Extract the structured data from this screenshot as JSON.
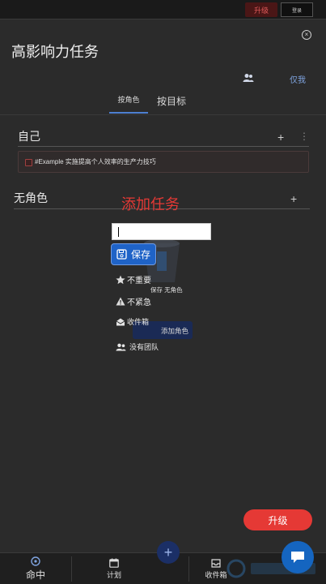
{
  "topbar": {
    "upgrade_label": "升级",
    "user_label": "登录"
  },
  "header": {
    "title": "高影响力任务",
    "only_me": "仅我"
  },
  "tabs": [
    {
      "label": "按角色",
      "active": true
    },
    {
      "label": "按目标",
      "active": false
    }
  ],
  "sections": [
    {
      "title": "自己"
    },
    {
      "title": "无角色"
    }
  ],
  "task": {
    "text": "#Example 实施提高个人效率的生产力技巧"
  },
  "background": {
    "save_label": "保存 无角色",
    "add_role_label": "添加角色"
  },
  "dialog": {
    "title": "添加任务",
    "input_value": "",
    "save_label": "保存",
    "options": [
      {
        "icon": "star-icon",
        "label": "不重要"
      },
      {
        "icon": "warning-icon",
        "label": "不紧急"
      },
      {
        "icon": "inbox-icon",
        "label": "收件箱"
      },
      {
        "icon": "team-icon",
        "label": "没有团队"
      }
    ]
  },
  "upgrade_button": "升级",
  "bottom_nav": [
    {
      "icon": "compass-icon",
      "label": "命中"
    },
    {
      "icon": "calendar-icon",
      "label": "计划"
    },
    {
      "icon": "inbox-icon",
      "label": "收件箱"
    }
  ],
  "colors": {
    "background": "#2b2b2b",
    "accent_red": "#e53935",
    "accent_blue": "#1f63c7",
    "link_blue": "#7fa4e0"
  }
}
